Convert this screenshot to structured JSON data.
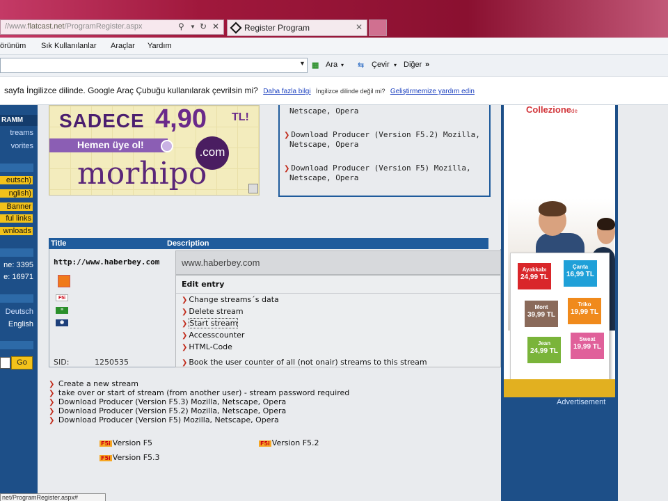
{
  "browser": {
    "address_domain": "flatcast.net",
    "address_prefix": "//www.",
    "address_path": "/ProgramRegister.aspx",
    "tab_title": "Register Program",
    "menu": [
      "örünüm",
      "Sık Kullanılanlar",
      "Araçlar",
      "Yardım"
    ],
    "toolbar": {
      "search_label": "Ara",
      "translate_label": "Çevir",
      "more_label": "Diğer"
    },
    "translate_bar": {
      "message": "sayfa İngilizce dilinde. Google Araç Çubuğu kullanılarak çevrilsin mi?",
      "more_info": "Daha fazla bilgi",
      "not_english": "İngilizce dilinde değil mi?",
      "help_link": "Geliştirmemize yardım edin"
    },
    "status_text": "net/ProgramRegister.aspx#"
  },
  "left_sidebar": {
    "header": "RAMM",
    "links": [
      "treams",
      "vorites"
    ],
    "yellow_items": [
      "eutsch)",
      "nglish)",
      "Banner",
      "ful links",
      "wnloads"
    ],
    "stats": [
      "ne: 3395",
      "e: 16971"
    ],
    "languages": [
      "Deutsch",
      "English"
    ],
    "go_label": "Go"
  },
  "banner_ad": {
    "line1": "SADECE",
    "price": "4,90",
    "currency": "TL!",
    "cta": "Hemen üye ol!",
    "brand": "morhipo",
    "tld": ".com"
  },
  "download_box": {
    "items": [
      {
        "text": "Netscape, Opera"
      },
      {
        "text": "Download Producer (Version F5.2) Mozilla,",
        "cont": "Netscape, Opera"
      },
      {
        "text": "Download Producer (Version F5) Mozilla,",
        "cont": "Netscape, Opera"
      }
    ]
  },
  "right_ad": {
    "brand": "Collezione",
    "brand_suffix": "de",
    "tiles": [
      {
        "name": "Ayakkabı",
        "price": "24,99 TL",
        "color": "#d9262a"
      },
      {
        "name": "Çanta",
        "price": "16,99 TL",
        "color": "#1fa0d8"
      },
      {
        "name": "Mont",
        "price": "39,99 TL",
        "color": "#8a6a5a"
      },
      {
        "name": "Triko",
        "price": "19,99 TL",
        "color": "#f08a1c"
      },
      {
        "name": "Jean",
        "price": "24,99 TL",
        "color": "#7ab43a"
      },
      {
        "name": "Sweat",
        "price": "19,99 TL",
        "color": "#e0609a"
      }
    ],
    "advertisement": "Advertisement"
  },
  "stream_table": {
    "col_title": "Title",
    "col_description": "Description",
    "url": "http://www.haberbey.com",
    "description": "www.haberbey.com",
    "edit_heading": "Edit entry",
    "actions": [
      "Change streams´s data",
      "Delete stream",
      "Start stream",
      "Accesscounter",
      "HTML-Code",
      "Book the user counter of all (not onair) streams to this stream"
    ],
    "sid_label": "SID:",
    "sid_value": "1250535"
  },
  "bottom_links": [
    "Create a new stream",
    "take over or start of stream (from another user) - stream password required",
    "Download Producer (Version F5.3) Mozilla, Netscape, Opera",
    "Download Producer (Version F5.2) Mozilla, Netscape, Opera",
    "Download Producer (Version F5) Mozilla, Netscape, Opera"
  ],
  "versions": [
    {
      "badge": "F5i",
      "label": "Version F5"
    },
    {
      "badge": "F5i",
      "label": "Version F5.2"
    },
    {
      "badge": "F5i",
      "label": "Version F5.3"
    }
  ]
}
